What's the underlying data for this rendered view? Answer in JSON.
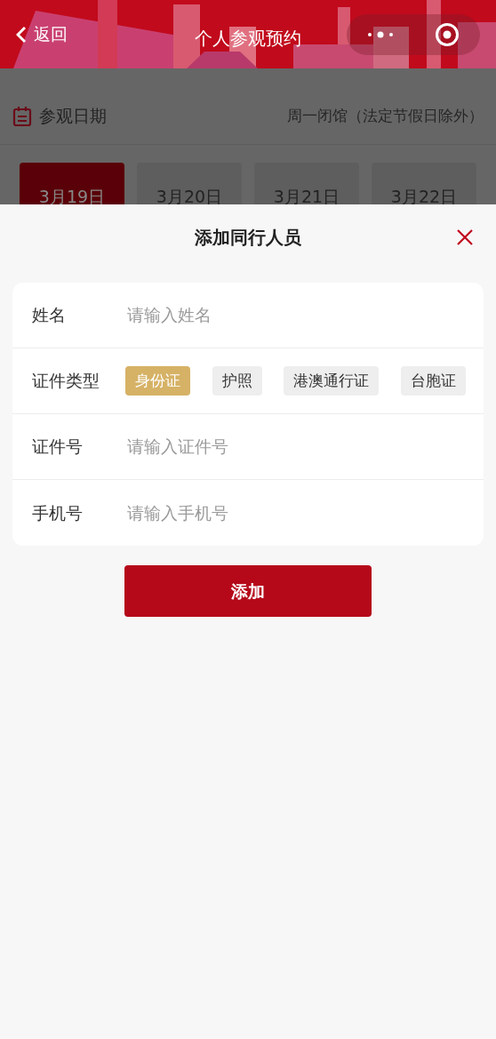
{
  "header": {
    "back_label": "返回",
    "title": "个人参观预约"
  },
  "visit_date": {
    "label": "参观日期",
    "note": "周一闭馆（法定节假日除外）",
    "dates": [
      {
        "label": "3月19日",
        "selected": true
      },
      {
        "label": "3月20日",
        "selected": false
      },
      {
        "label": "3月21日",
        "selected": false
      },
      {
        "label": "3月22日",
        "selected": false
      }
    ]
  },
  "sheet": {
    "title": "添加同行人员",
    "fields": [
      {
        "kind": "input",
        "label": "姓名",
        "placeholder": "请输入姓名"
      },
      {
        "kind": "options",
        "label": "证件类型",
        "options": [
          {
            "label": "身份证",
            "selected": true
          },
          {
            "label": "护照",
            "selected": false
          },
          {
            "label": "港澳通行证",
            "selected": false
          },
          {
            "label": "台胞证",
            "selected": false
          }
        ]
      },
      {
        "kind": "input",
        "label": "证件号",
        "placeholder": "请输入证件号"
      },
      {
        "kind": "input",
        "label": "手机号",
        "placeholder": "请输入手机号"
      }
    ],
    "submit": "添加"
  }
}
